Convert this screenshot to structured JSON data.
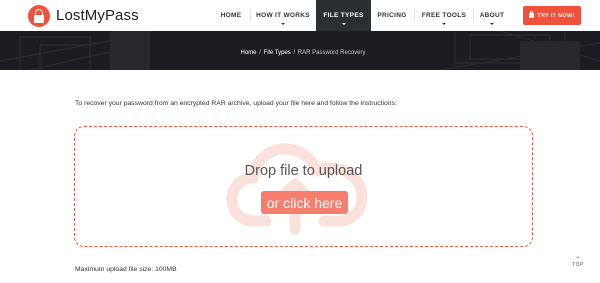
{
  "brand": {
    "name": "LostMyPass",
    "logo_icon": "padlock-icon",
    "color": "#f0523d"
  },
  "nav": {
    "items": [
      {
        "label": "HOME",
        "active": false
      },
      {
        "label": "HOW IT WORKS",
        "active": false,
        "has_dropdown": true
      },
      {
        "label": "FILE TYPES",
        "active": true,
        "has_dropdown": true
      },
      {
        "label": "PRICING",
        "active": false
      },
      {
        "label": "FREE TOOLS",
        "active": false,
        "has_dropdown": true
      },
      {
        "label": "ABOUT",
        "active": false,
        "has_dropdown": true
      }
    ],
    "cta_label": "TRY IT NOW!",
    "cta_icon": "lock-icon"
  },
  "breadcrumb": {
    "home": "Home",
    "file_types": "File Types",
    "current": "RAR Password Recovery",
    "separator": "/"
  },
  "main": {
    "instructions": "To recover your password from an encrypted RAR archive, upload your file here and follow the instructions:",
    "dropzone": {
      "title": "Drop file to upload",
      "button_label": "or click here",
      "icon": "cloud-upload-icon"
    },
    "max_size": "Maximum upload file size: 100MB"
  },
  "scroll_top": {
    "label": "TOP",
    "icon": "arrow-up-icon"
  },
  "colors": {
    "accent": "#f0523d",
    "dark": "#2b2e33",
    "button_light": "#f57f6c"
  }
}
